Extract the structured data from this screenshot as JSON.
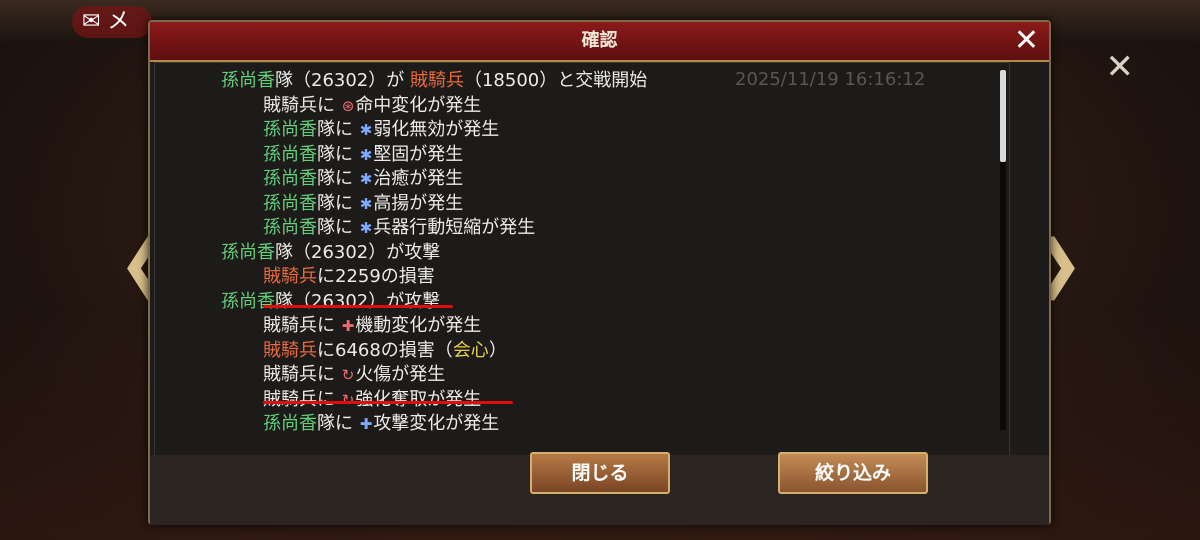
{
  "background": {
    "mail_label": "✉ メ",
    "close_symbol": "✕",
    "left_arrow": "❮",
    "right_arrow": "❯"
  },
  "dialog": {
    "title": "確認",
    "close_symbol": "✕",
    "timestamp": "2025/11/19 16:16:12",
    "lines": [
      {
        "indent": false,
        "segments": [
          {
            "text": "孫尚香",
            "color": "g"
          },
          {
            "text": "隊（26302）が ",
            "color": "w"
          },
          {
            "text": "賊騎兵",
            "color": "o"
          },
          {
            "text": "（18500）と交戦開始",
            "color": "w"
          }
        ]
      },
      {
        "indent": true,
        "segments": [
          {
            "text": "賊騎兵に ",
            "color": "w"
          },
          {
            "text": "⊛",
            "color": "icr"
          },
          {
            "text": "命中変化が発生",
            "color": "w"
          }
        ]
      },
      {
        "indent": true,
        "segments": [
          {
            "text": "孫尚香",
            "color": "g"
          },
          {
            "text": "隊に ",
            "color": "w"
          },
          {
            "text": "✱",
            "color": "ic"
          },
          {
            "text": "弱化無効が発生",
            "color": "w"
          }
        ]
      },
      {
        "indent": true,
        "segments": [
          {
            "text": "孫尚香",
            "color": "g"
          },
          {
            "text": "隊に ",
            "color": "w"
          },
          {
            "text": "✱",
            "color": "ic"
          },
          {
            "text": "堅固が発生",
            "color": "w"
          }
        ]
      },
      {
        "indent": true,
        "segments": [
          {
            "text": "孫尚香",
            "color": "g"
          },
          {
            "text": "隊に ",
            "color": "w"
          },
          {
            "text": "✱",
            "color": "ic"
          },
          {
            "text": "治癒が発生",
            "color": "w"
          }
        ]
      },
      {
        "indent": true,
        "segments": [
          {
            "text": "孫尚香",
            "color": "g"
          },
          {
            "text": "隊に ",
            "color": "w"
          },
          {
            "text": "✱",
            "color": "ic"
          },
          {
            "text": "高揚が発生",
            "color": "w"
          }
        ]
      },
      {
        "indent": true,
        "segments": [
          {
            "text": "孫尚香",
            "color": "g"
          },
          {
            "text": "隊に ",
            "color": "w"
          },
          {
            "text": "✱",
            "color": "ic"
          },
          {
            "text": "兵器行動短縮が発生",
            "color": "w"
          }
        ]
      },
      {
        "indent": false,
        "segments": [
          {
            "text": "孫尚香",
            "color": "g"
          },
          {
            "text": "隊（26302）が攻撃",
            "color": "w"
          }
        ]
      },
      {
        "indent": true,
        "segments": [
          {
            "text": "賊騎兵",
            "color": "o"
          },
          {
            "text": "に2259の損害",
            "color": "w"
          }
        ]
      },
      {
        "indent": false,
        "segments": [
          {
            "text": "孫尚香",
            "color": "g"
          },
          {
            "text": "隊（26302）が攻撃",
            "color": "w"
          }
        ]
      },
      {
        "indent": true,
        "segments": [
          {
            "text": "賊騎兵に ",
            "color": "w"
          },
          {
            "text": "✚",
            "color": "icr"
          },
          {
            "text": "機動変化が発生",
            "color": "w"
          }
        ]
      },
      {
        "indent": true,
        "segments": [
          {
            "text": "賊騎兵",
            "color": "o"
          },
          {
            "text": "に6468の損害（",
            "color": "w"
          },
          {
            "text": "会心",
            "color": "y"
          },
          {
            "text": "）",
            "color": "w"
          }
        ]
      },
      {
        "indent": true,
        "segments": [
          {
            "text": "賊騎兵に ",
            "color": "w"
          },
          {
            "text": "↻",
            "color": "icr"
          },
          {
            "text": "火傷が発生",
            "color": "w"
          }
        ]
      },
      {
        "indent": true,
        "segments": [
          {
            "text": "賊騎兵に ",
            "color": "w"
          },
          {
            "text": "↻",
            "color": "icr"
          },
          {
            "text": "強化奪取が発生",
            "color": "w"
          }
        ]
      },
      {
        "indent": true,
        "segments": [
          {
            "text": "孫尚香",
            "color": "g"
          },
          {
            "text": "隊に ",
            "color": "w"
          },
          {
            "text": "✚",
            "color": "ic"
          },
          {
            "text": "攻撃変化が発生",
            "color": "w"
          }
        ]
      }
    ],
    "buttons": {
      "close_label": "閉じる",
      "filter_label": "絞り込み"
    }
  }
}
